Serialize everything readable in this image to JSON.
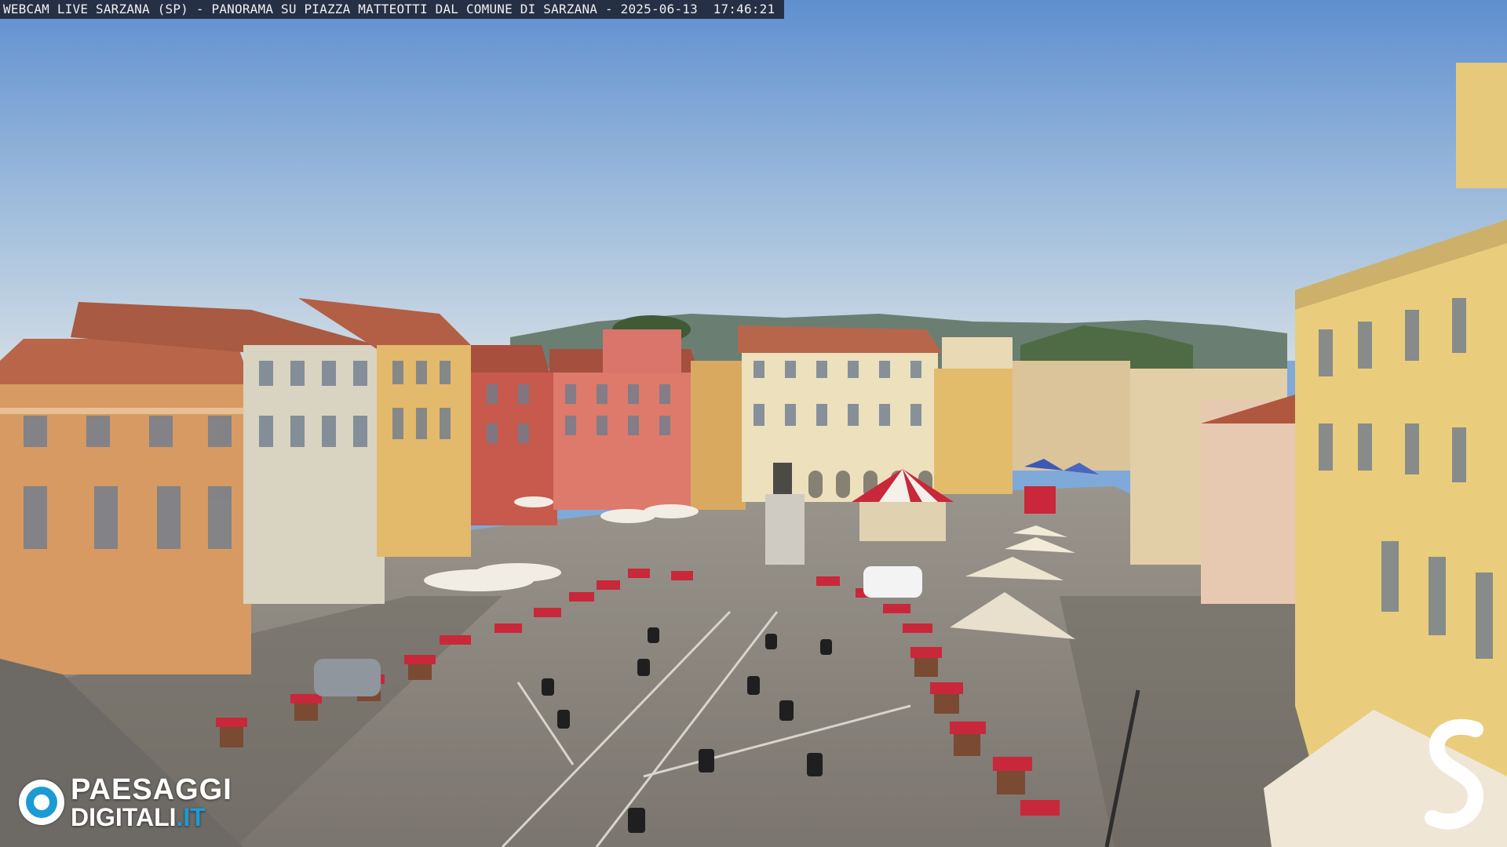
{
  "overlay": {
    "caption": "WEBCAM LIVE SARZANA (SP) - PANORAMA SU PIAZZA MATTEOTTI DAL COMUNE DI SARZANA - 2025-06-13  17:46:21"
  },
  "logo": {
    "line1": "PAESAGGI",
    "line2_main": "DIGITALI",
    "line2_tld": ".IT",
    "icon": "camera-lens-icon"
  },
  "brand_mark": {
    "icon": "stylized-s-logo-icon"
  },
  "colors": {
    "sky_top": "#6b9ad4",
    "sky_bottom": "#c9d9e6",
    "pavement": "#8c8780",
    "logo_blue": "#1c9ad6",
    "awning_red": "#c8283a"
  }
}
